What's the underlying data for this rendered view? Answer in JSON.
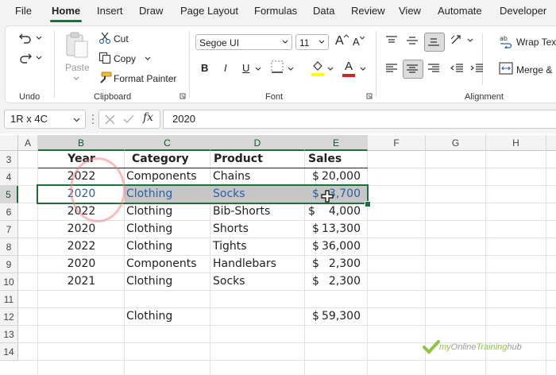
{
  "menu": {
    "tabs": [
      "File",
      "Home",
      "Insert",
      "Draw",
      "Page Layout",
      "Formulas",
      "Data",
      "Review",
      "View",
      "Automate",
      "Developer"
    ],
    "active": "Home"
  },
  "ribbon": {
    "undo_group_label": "Undo",
    "clipboard": {
      "label": "Clipboard",
      "paste": "Paste",
      "cut": "Cut",
      "copy": "Copy",
      "format_painter": "Format Painter"
    },
    "font": {
      "label": "Font",
      "font_name": "Segoe UI",
      "font_size": "11",
      "bold": "B",
      "italic": "I",
      "underline": "U",
      "font_color_letter": "A",
      "grow_letter": "A",
      "shrink_letter": "A"
    },
    "alignment": {
      "label": "Alignment",
      "wrap_text": "Wrap Text",
      "merge": "Merge &"
    }
  },
  "formula_bar": {
    "name_box": "1R x 4C",
    "fx": "fx",
    "value": "2020"
  },
  "columns": [
    "A",
    "B",
    "C",
    "D",
    "E",
    "F",
    "G",
    "H"
  ],
  "rows": [
    "3",
    "4",
    "5",
    "6",
    "7",
    "8",
    "9",
    "10",
    "11",
    "12",
    "13",
    "14"
  ],
  "table": {
    "headers": [
      "Year",
      "Category",
      "Product",
      "Sales"
    ],
    "data": [
      [
        "2022",
        "Components",
        "Chains",
        "$",
        "20,000"
      ],
      [
        "2020",
        "Clothing",
        "Socks",
        "$",
        "3,700"
      ],
      [
        "2022",
        "Clothing",
        "Bib-Shorts",
        "$",
        "4,000"
      ],
      [
        "2020",
        "Clothing",
        "Shorts",
        "$",
        "13,300"
      ],
      [
        "2022",
        "Clothing",
        "Tights",
        "$",
        "36,000"
      ],
      [
        "2020",
        "Components",
        "Handlebars",
        "$",
        "2,300"
      ],
      [
        "2021",
        "Clothing",
        "Socks",
        "$",
        "2,300"
      ]
    ],
    "total_row": [
      "Clothing",
      "$",
      "59,300"
    ]
  },
  "watermark": {
    "part1": "my",
    "part2": "Online",
    "part3": "Training",
    "part4": "hub"
  },
  "colors": {
    "accent": "#1e6e3e",
    "selection_text": "#2a5fa8",
    "watermark_green": "#8cc63f",
    "watermark_gray": "#9a9a9a"
  }
}
